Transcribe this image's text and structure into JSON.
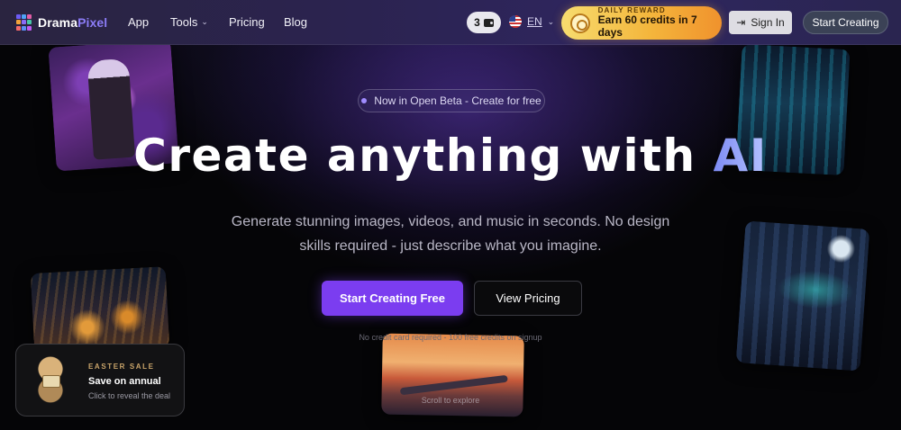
{
  "brand": {
    "name_part1": "Drama",
    "name_part2": "Pixel",
    "accent_color": "#8b7cf6"
  },
  "nav": {
    "links": [
      {
        "label": "App"
      },
      {
        "label": "Tools"
      },
      {
        "label": "Pricing"
      },
      {
        "label": "Blog"
      }
    ],
    "credits_count": "3",
    "language": "EN",
    "reward": {
      "kicker": "DAILY REWARD",
      "main": "Earn 60 credits in 7 days"
    },
    "signin_label": "Sign In",
    "start_label": "Start Creating"
  },
  "hero": {
    "beta_badge": "Now in Open Beta - Create for free",
    "title_main": "Create anything with ",
    "title_accent": "AI",
    "subtitle": "Generate stunning images, videos, and music in seconds. No design skills required - just describe what you imagine.",
    "cta_primary": "Start Creating Free",
    "cta_secondary": "View Pricing",
    "fineprint": "No credit card required - 100 free credits on signup",
    "scroll_hint": "Scroll to explore"
  },
  "promo": {
    "kicker": "EASTER SALE",
    "title": "Save on annual",
    "subtitle": "Click to reveal the deal"
  },
  "colors": {
    "primary_button": "#7b3df0",
    "reward_gradient_start": "#f7dc6f",
    "reward_gradient_end": "#f0922d"
  },
  "icons": [
    "logo-grid-icon",
    "chevron-down-icon",
    "wallet-icon",
    "us-flag-icon",
    "coin-icon",
    "sign-in-icon",
    "beta-dot-icon"
  ]
}
